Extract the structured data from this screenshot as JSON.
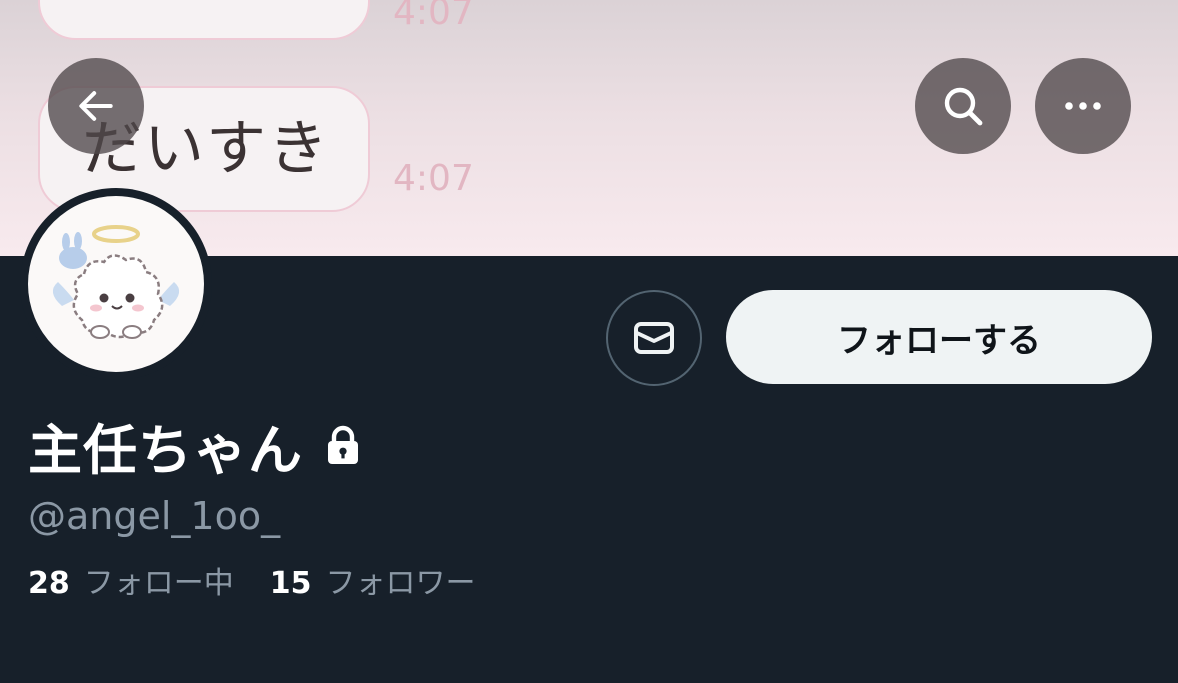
{
  "banner": {
    "bubble_top_time": "4:07",
    "bubble_main_text": "だいすき",
    "bubble_main_time": "4:07"
  },
  "icons": {
    "back": "arrow-left-icon",
    "search": "search-icon",
    "more": "more-horizontal-icon",
    "mail": "mail-icon",
    "lock": "lock-icon"
  },
  "actions": {
    "follow_label": "フォローする"
  },
  "profile": {
    "display_name": "主任ちゃん",
    "handle": "@angel_1oo_",
    "following_count": "28",
    "following_label": "フォロー中",
    "followers_count": "15",
    "followers_label": "フォロワー"
  },
  "colors": {
    "background": "#17202a",
    "follow_button_bg": "#eff3f4",
    "secondary_text": "#8b98a5",
    "timestamp_pink": "#e2b6c2"
  }
}
